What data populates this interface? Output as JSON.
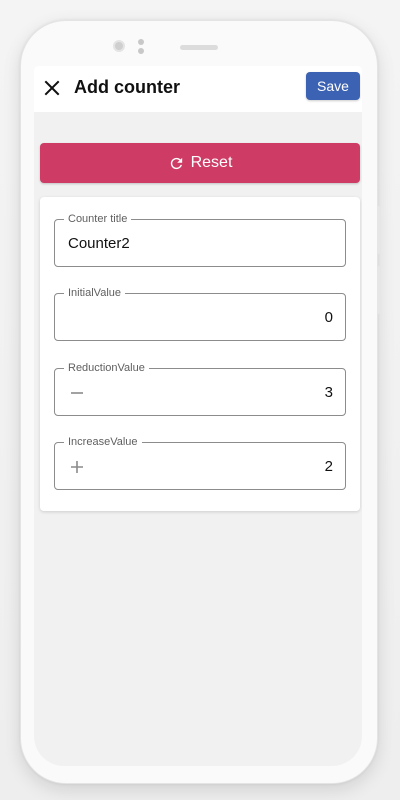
{
  "appbar": {
    "title": "Add counter",
    "save_label": "Save"
  },
  "reset": {
    "label": "Reset",
    "icon": "refresh-icon"
  },
  "form": {
    "title_field": {
      "label": "Counter title",
      "value": "Counter2"
    },
    "initial_field": {
      "label": "InitialValue",
      "value": "0"
    },
    "reduction_field": {
      "label": "ReductionValue",
      "value": "3",
      "icon": "minus-icon"
    },
    "increase_field": {
      "label": "IncreaseValue",
      "value": "2",
      "icon": "plus-icon"
    }
  },
  "colors": {
    "save_button": "#3c63b3",
    "reset_button": "#ce3c65",
    "screen_background": "#f1f1f1",
    "card_background": "#ffffff"
  }
}
